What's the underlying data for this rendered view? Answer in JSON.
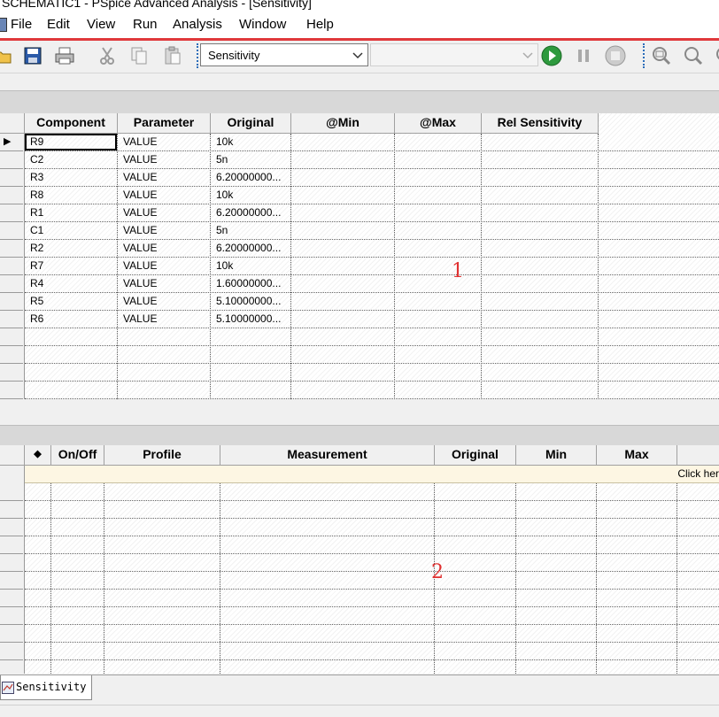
{
  "window": {
    "title": "SCHEMATIC1 - PSpice Advanced Analysis - [Sensitivity]"
  },
  "menu": [
    "File",
    "Edit",
    "View",
    "Run",
    "Analysis",
    "Window",
    "Help"
  ],
  "toolbar": {
    "analysis_select": "Sensitivity",
    "icons": [
      "open-icon",
      "save-icon",
      "print-icon",
      "cut-icon",
      "copy-icon",
      "paste-icon",
      "run-icon",
      "pause-icon",
      "stop-icon",
      "zoom-fit-icon",
      "zoom-in-icon"
    ]
  },
  "parameters_table": {
    "columns": [
      "Component",
      "Parameter",
      "Original",
      "@Min",
      "@Max",
      "Rel Sensitivity"
    ],
    "rows": [
      [
        "R9",
        "VALUE",
        "10k",
        "",
        "",
        ""
      ],
      [
        "C2",
        "VALUE",
        "5n",
        "",
        "",
        ""
      ],
      [
        "R3",
        "VALUE",
        "6.20000000...",
        "",
        "",
        ""
      ],
      [
        "R8",
        "VALUE",
        "10k",
        "",
        "",
        ""
      ],
      [
        "R1",
        "VALUE",
        "6.20000000...",
        "",
        "",
        ""
      ],
      [
        "C1",
        "VALUE",
        "5n",
        "",
        "",
        ""
      ],
      [
        "R2",
        "VALUE",
        "6.20000000...",
        "",
        "",
        ""
      ],
      [
        "R7",
        "VALUE",
        "10k",
        "",
        "",
        ""
      ],
      [
        "R4",
        "VALUE",
        "1.60000000...",
        "",
        "",
        ""
      ],
      [
        "R5",
        "VALUE",
        "5.10000000...",
        "",
        "",
        ""
      ],
      [
        "R6",
        "VALUE",
        "5.10000000...",
        "",
        "",
        ""
      ]
    ],
    "current_row_marker": "▶",
    "annotation": "1"
  },
  "measurements_table": {
    "columns": [
      "◆",
      "On/Off",
      "Profile",
      "Measurement",
      "Original",
      "Min",
      "Max",
      ""
    ],
    "add_row_text": "Click her",
    "annotation": "2"
  },
  "tabs": [
    {
      "label": "Sensitivity"
    }
  ]
}
